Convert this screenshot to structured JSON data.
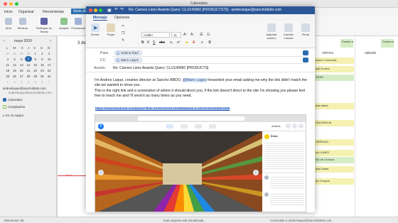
{
  "app": {
    "title": "Calendario"
  },
  "ribbon": {
    "tabs": [
      "Inicio",
      "Organizar",
      "Herramientas",
      "Serie de reuniones"
    ],
    "buttons": [
      "Abrir",
      "Eliminar",
      "Participar en Teams",
      "Aceptar",
      "Provisional"
    ]
  },
  "sidebar": {
    "month": "mayo 2020",
    "weekdays": [
      "L",
      "M",
      "X",
      "J",
      "V",
      "S",
      "D"
    ],
    "weeks": [
      [
        "27",
        "28",
        "29",
        "30",
        "1",
        "2",
        "3"
      ],
      [
        "4",
        "5",
        "6",
        "7",
        "8",
        "9",
        "10"
      ],
      [
        "11",
        "12",
        "13",
        "14",
        "15",
        "16",
        "17"
      ],
      [
        "18",
        "19",
        "20",
        "21",
        "22",
        "23",
        "24"
      ],
      [
        "25",
        "26",
        "27",
        "28",
        "29",
        "30",
        "31"
      ],
      [
        "1",
        "2",
        "3",
        "4",
        "5",
        "6",
        "7"
      ]
    ],
    "selected_day": "7",
    "account_email": "andresluque@sanchobbdo.com",
    "account_sub": "andresluque@sanchobbdo.com",
    "items": [
      "Calendario",
      "Cumpleaños",
      "En mi equipo"
    ]
  },
  "calendar": {
    "header_prefix": "3 de m",
    "days": [
      "viernes",
      "sábado"
    ],
    "day_numbers": [
      "5",
      "10"
    ],
    "notes": [
      "Festivo de Colombia",
      "Festivo de Colombia"
    ],
    "side_time": "19:54",
    "events": [
      "nuevo Colombia,",
      "ada Sucesi",
      "TRATI",
      "ada diaria",
      "ONCIENCIA",
      "VERIDAD -",
      "do LUNES",
      "tos de Crónica",
      "ada Diaria",
      "do Compra"
    ]
  },
  "status": {
    "left": "Elementos: 50",
    "center": "Esta carpeta está actualizada.",
    "right": "Conectado a andresluque@sanchobbdo.com"
  },
  "message": {
    "title": "Re: Cannes Lions Awards Query: CL/J149960 [PRODUCTS73] - andresluque@sanchobbdo.com",
    "tabs": [
      "Mensaje",
      "Opciones"
    ],
    "ribbon": {
      "send": "Enviar",
      "paste": "Pegar",
      "font": "Calibri",
      "size": "11",
      "attach_file": "Adjuntar archivo",
      "insert_link": "Insertar vínculo",
      "more": "Firma"
    },
    "labels": {
      "to": "Para:",
      "cc": "CC:",
      "subject": "Asunto:"
    },
    "to": [
      "Helena Ried"
    ],
    "cc": [
      "Mario Lagos"
    ],
    "subject": "Re: Cannes Lions Awards Query: CL/J149960 [PRODUCTS]",
    "body_1a": "I'm Andres Luque, creative director at Sancho BBDO, ",
    "mention": "@Mario Lagos",
    "body_1b": " forwarded your email asking me why the link didn't match the site we wanted to show you.",
    "body_2": "This is the right link and a screenshot of where it should direct you, if the link doesn't direct to the site I'm showing you please feel free to reach me and I'll send it as many times as you need.",
    "link": "https://www.facebook.com/photo?fbid=10157424214336598&set=a.10152392468561598"
  },
  "screenshot": {
    "fb_logo": "f",
    "post_author": "Éxito",
    "page_name": "Andres"
  }
}
